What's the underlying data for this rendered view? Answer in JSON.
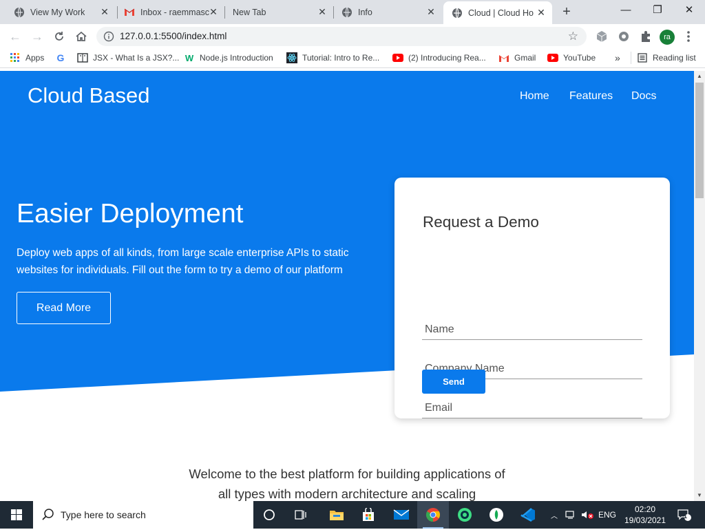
{
  "browser": {
    "tabs": [
      {
        "title": "View My Work",
        "icon": "globe-icon",
        "active": false
      },
      {
        "title": "Inbox - raemmasc",
        "icon": "gmail-icon",
        "active": false
      },
      {
        "title": "New Tab",
        "icon": "none",
        "active": false
      },
      {
        "title": "Info",
        "icon": "globe-icon",
        "active": false
      },
      {
        "title": "Cloud | Cloud Ho",
        "icon": "globe-icon",
        "active": true
      }
    ],
    "new_tab": "+",
    "window_controls": {
      "minimize": "—",
      "restore": "❐",
      "close": "✕"
    },
    "url": "127.0.0.1:5500/index.html",
    "avatar_initials": "ra",
    "bookmarks": [
      {
        "label": "Apps",
        "icon": "apps-grid-icon"
      },
      {
        "label": "",
        "icon": "google-icon"
      },
      {
        "label": "JSX - What Is a JSX?...",
        "icon": "book-icon"
      },
      {
        "label": "Node.js Introduction",
        "icon": "w3schools-icon"
      },
      {
        "label": "Tutorial: Intro to Re...",
        "icon": "react-icon"
      },
      {
        "label": "(2) Introducing Rea...",
        "icon": "youtube-icon"
      },
      {
        "label": "Gmail",
        "icon": "gmail-icon"
      },
      {
        "label": "YouTube",
        "icon": "youtube-icon"
      }
    ],
    "bookmarks_overflow": "»",
    "reading_list": "Reading list"
  },
  "page": {
    "brand": "Cloud Based",
    "nav": [
      "Home",
      "Features",
      "Docs"
    ],
    "hero": {
      "title": "Easier Deployment",
      "text": "Deploy web apps of all kinds, from large scale enterprise APIs to static websites for individuals. Fill out the form to try a demo of our platform",
      "button": "Read More"
    },
    "form": {
      "title": "Request a Demo",
      "fields": [
        "Name",
        "Company Name",
        "Email"
      ],
      "submit": "Send"
    },
    "welcome": "Welcome to the best platform for building applications of all types with modern architecture and scaling"
  },
  "colors": {
    "hero_blue": "#0a7aec",
    "button_blue": "#0a7aec",
    "taskbar": "#1f2a35"
  },
  "taskbar": {
    "search_placeholder": "Type here to search",
    "apps": [
      "cortana-icon",
      "task-view-icon",
      "file-explorer-icon",
      "store-icon",
      "mail-icon",
      "chrome-icon",
      "android-studio-icon",
      "mongodb-icon",
      "vscode-icon"
    ],
    "language": "ENG",
    "time": "02:20",
    "date": "19/03/2021",
    "notification_count": "1"
  }
}
